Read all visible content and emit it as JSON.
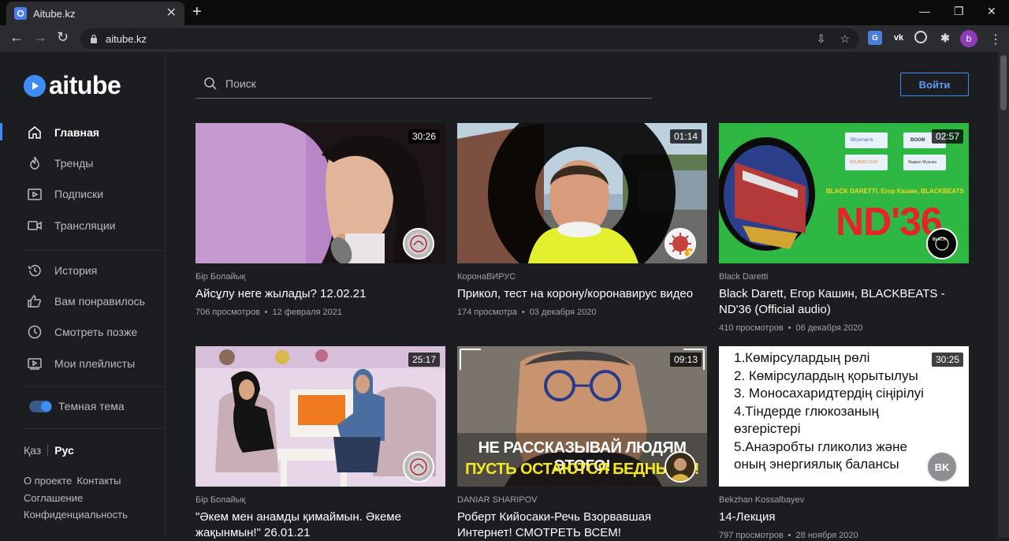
{
  "browser": {
    "tab_title": "Aitube.kz",
    "url": "aitube.kz",
    "profile_initial": "b"
  },
  "brand": {
    "logo_text": "aitube",
    "accent": "#3f8cf5"
  },
  "search": {
    "placeholder": "Поиск"
  },
  "header": {
    "login_label": "Войти"
  },
  "sidebar": {
    "items": [
      {
        "label": "Главная",
        "icon": "home-icon"
      },
      {
        "label": "Тренды",
        "icon": "flame-icon"
      },
      {
        "label": "Подписки",
        "icon": "subscriptions-icon"
      },
      {
        "label": "Трансляции",
        "icon": "live-camera-icon"
      },
      {
        "label": "История",
        "icon": "history-icon"
      },
      {
        "label": "Вам понравилось",
        "icon": "thumbs-up-icon"
      },
      {
        "label": "Смотреть позже",
        "icon": "clock-icon"
      },
      {
        "label": "Мои плейлисты",
        "icon": "playlist-icon"
      }
    ],
    "theme_label": "Темная тема",
    "lang_kz": "Қаз",
    "lang_ru": "Рус",
    "footer": [
      "О проекте",
      "Контакты",
      "Соглашение",
      "Конфиденциальность"
    ]
  },
  "videos": [
    {
      "duration": "30:26",
      "channel": "Бір Болайық",
      "title": "Айсұлу неге жылады? 12.02.21",
      "views": "706 просмотров",
      "date": "12 февраля 2021"
    },
    {
      "duration": "01:14",
      "channel": "КоронаВИРУС",
      "title": "Прикол, тест на корону/коронавирус видео",
      "views": "174 просмотра",
      "date": "03 декабря 2020"
    },
    {
      "duration": "02:57",
      "channel": "Black Daretti",
      "title": "Black Darett, Егор Кашин, BLACKBEATS - ND'36 (Official audio)",
      "views": "410 просмотров",
      "date": "06 декабря 2020",
      "thumb_text_1": "BLACK DARETTI, Егор Кашин, BLACKBEATS",
      "thumb_text_2": "ND'36",
      "social": [
        "ВКонтакте",
        "BOOM",
        "SOUNDCLOUD",
        "Яндекс Музыка"
      ]
    },
    {
      "duration": "25:17",
      "channel": "Бір Болайық",
      "title": "\"Әкем мен анамды қимаймын. Әкеме жақынмын!\" 26.01.21",
      "views": "",
      "date": ""
    },
    {
      "duration": "09:13",
      "channel": "DANIAR SHARIPOV",
      "title": "Роберт Кийосаки-Речь Взорвавшая Интернет! СМОТРЕТЬ ВСЕМ!",
      "views": "",
      "date": "",
      "caption_1": "НЕ РАССКАЗЫВАЙ ЛЮДЯМ ЭТОГО!",
      "caption_2": "ПУСТЬ ОСТАЮТСЯ БЕДНЫМИ!"
    },
    {
      "duration": "30:25",
      "channel": "Bekzhan Kossalbayev",
      "title": "14-Лекция",
      "views": "797 просмотров",
      "date": "28 ноября 2020",
      "avatar_initials": "BK",
      "slide_lines": [
        "1.Көмірсулардың рөлі",
        "2. Көмірсулардың қорытылуы",
        "3. Моносахаридтердің сіңірілуі",
        "4.Тіндерде глюкозаның",
        "өзгерістері",
        "5.Анаэробты гликолиз және",
        "оның энергиялық балансы"
      ]
    }
  ]
}
